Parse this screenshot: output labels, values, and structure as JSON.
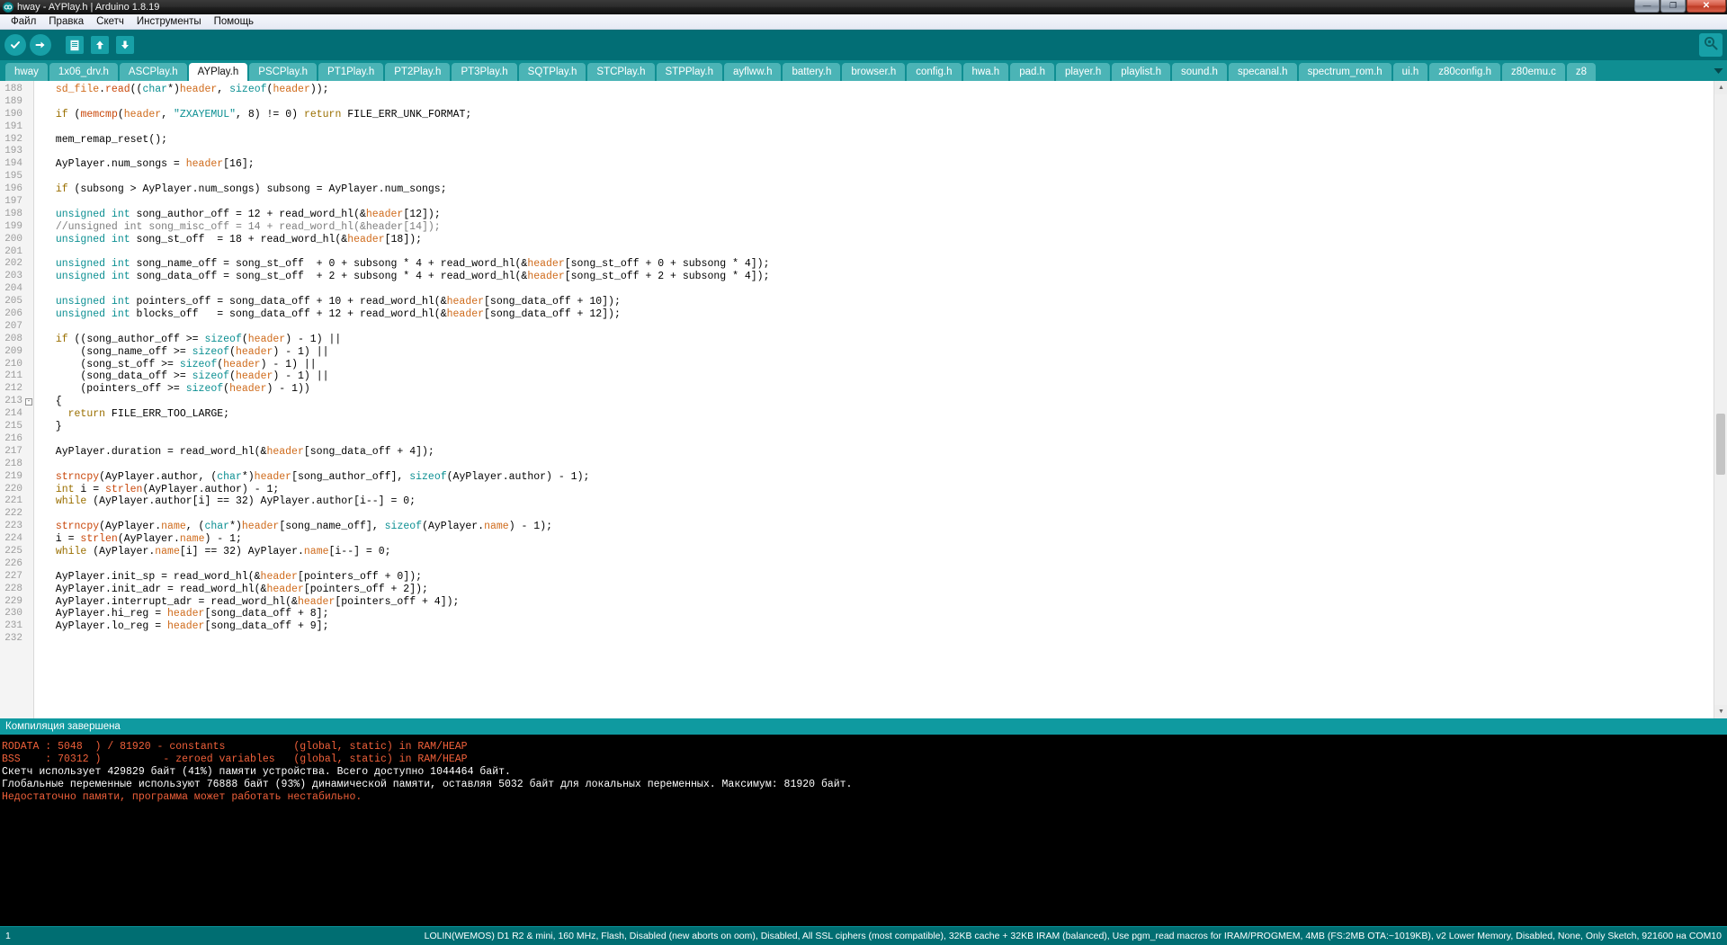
{
  "window": {
    "title": "hway - AYPlay.h | Arduino 1.8.19",
    "app_icon": "arduino-infinity-icon",
    "minimize_glyph": "—",
    "maximize_glyph": "❐",
    "close_glyph": "✕"
  },
  "menubar": {
    "items": [
      {
        "label": "Файл",
        "name": "menu-file"
      },
      {
        "label": "Правка",
        "name": "menu-edit"
      },
      {
        "label": "Скетч",
        "name": "menu-sketch"
      },
      {
        "label": "Инструменты",
        "name": "menu-tools"
      },
      {
        "label": "Помощь",
        "name": "menu-help"
      }
    ]
  },
  "toolbar": {
    "buttons": [
      {
        "name": "verify-button",
        "icon": "checkmark-icon",
        "glyph": "✔",
        "shape": "round"
      },
      {
        "name": "upload-button",
        "icon": "arrow-right-icon",
        "glyph": "➜",
        "shape": "round"
      },
      {
        "name": "new-button",
        "icon": "new-file-icon",
        "glyph": "▤",
        "shape": "square"
      },
      {
        "name": "open-button",
        "icon": "arrow-up-icon",
        "glyph": "▲",
        "shape": "square"
      },
      {
        "name": "save-button",
        "icon": "arrow-down-icon",
        "glyph": "▼",
        "shape": "square"
      }
    ],
    "serial_monitor": {
      "name": "serial-monitor-button",
      "icon": "magnifier-icon",
      "glyph": "🔍"
    }
  },
  "tabs": {
    "active": "AYPlay.h",
    "scroll_glyph": "▼",
    "items": [
      "hway",
      "1x06_drv.h",
      "ASCPlay.h",
      "AYPlay.h",
      "PSCPlay.h",
      "PT1Play.h",
      "PT2Play.h",
      "PT3Play.h",
      "SQTPlay.h",
      "STCPlay.h",
      "STPPlay.h",
      "ayflww.h",
      "battery.h",
      "browser.h",
      "config.h",
      "hwa.h",
      "pad.h",
      "player.h",
      "playlist.h",
      "sound.h",
      "specanal.h",
      "spectrum_rom.h",
      "ui.h",
      "z80config.h",
      "z80emu.c",
      "z8"
    ]
  },
  "editor": {
    "first_line": 188,
    "fold_line": 213,
    "fold_glyph": "⊟",
    "lines": [
      {
        "n": 188,
        "html": "  <span class=\"var\">sd_file</span>.<span class=\"fn\">read</span>((<span class=\"typ\">char</span>*)<span class=\"var\">header</span>, <span class=\"typ\">sizeof</span>(<span class=\"var\">header</span>));"
      },
      {
        "n": 189,
        "html": ""
      },
      {
        "n": 190,
        "html": "  <span class=\"kw\">if</span> (<span class=\"fn\">memcmp</span>(<span class=\"var\">header</span>, <span class=\"str\">\"ZXAYEMUL\"</span>, 8) != 0) <span class=\"kw\">return</span> FILE_ERR_UNK_FORMAT;"
      },
      {
        "n": 191,
        "html": ""
      },
      {
        "n": 192,
        "html": "  mem_remap_reset();"
      },
      {
        "n": 193,
        "html": ""
      },
      {
        "n": 194,
        "html": "  AyPlayer.num_songs = <span class=\"var\">header</span>[16];"
      },
      {
        "n": 195,
        "html": ""
      },
      {
        "n": 196,
        "html": "  <span class=\"kw\">if</span> (subsong &gt; AyPlayer.num_songs) subsong = AyPlayer.num_songs;"
      },
      {
        "n": 197,
        "html": ""
      },
      {
        "n": 198,
        "html": "  <span class=\"typ\">unsigned int</span> song_author_off = 12 + read_word_hl(&amp;<span class=\"var\">header</span>[12]);"
      },
      {
        "n": 199,
        "html": "  <span class=\"cmt\">//unsigned int song_misc_off = 14 + read_word_hl(&amp;header[14]);</span>"
      },
      {
        "n": 200,
        "html": "  <span class=\"typ\">unsigned int</span> song_st_off  = 18 + read_word_hl(&amp;<span class=\"var\">header</span>[18]);"
      },
      {
        "n": 201,
        "html": ""
      },
      {
        "n": 202,
        "html": "  <span class=\"typ\">unsigned int</span> song_name_off = song_st_off  + 0 + subsong * 4 + read_word_hl(&amp;<span class=\"var\">header</span>[song_st_off + 0 + subsong * 4]);"
      },
      {
        "n": 203,
        "html": "  <span class=\"typ\">unsigned int</span> song_data_off = song_st_off  + 2 + subsong * 4 + read_word_hl(&amp;<span class=\"var\">header</span>[song_st_off + 2 + subsong * 4]);"
      },
      {
        "n": 204,
        "html": ""
      },
      {
        "n": 205,
        "html": "  <span class=\"typ\">unsigned int</span> pointers_off = song_data_off + 10 + read_word_hl(&amp;<span class=\"var\">header</span>[song_data_off + 10]);"
      },
      {
        "n": 206,
        "html": "  <span class=\"typ\">unsigned int</span> blocks_off   = song_data_off + 12 + read_word_hl(&amp;<span class=\"var\">header</span>[song_data_off + 12]);"
      },
      {
        "n": 207,
        "html": ""
      },
      {
        "n": 208,
        "html": "  <span class=\"kw\">if</span> ((song_author_off &gt;= <span class=\"typ\">sizeof</span>(<span class=\"var\">header</span>) - 1) ||"
      },
      {
        "n": 209,
        "html": "      (song_name_off &gt;= <span class=\"typ\">sizeof</span>(<span class=\"var\">header</span>) - 1) ||"
      },
      {
        "n": 210,
        "html": "      (song_st_off &gt;= <span class=\"typ\">sizeof</span>(<span class=\"var\">header</span>) - 1) ||"
      },
      {
        "n": 211,
        "html": "      (song_data_off &gt;= <span class=\"typ\">sizeof</span>(<span class=\"var\">header</span>) - 1) ||"
      },
      {
        "n": 212,
        "html": "      (pointers_off &gt;= <span class=\"typ\">sizeof</span>(<span class=\"var\">header</span>) - 1))"
      },
      {
        "n": 213,
        "html": "  {"
      },
      {
        "n": 214,
        "html": "    <span class=\"kw\">return</span> FILE_ERR_TOO_LARGE;"
      },
      {
        "n": 215,
        "html": "  }"
      },
      {
        "n": 216,
        "html": ""
      },
      {
        "n": 217,
        "html": "  AyPlayer.duration = read_word_hl(&amp;<span class=\"var\">header</span>[song_data_off + 4]);"
      },
      {
        "n": 218,
        "html": ""
      },
      {
        "n": 219,
        "html": "  <span class=\"fn\">strncpy</span>(AyPlayer.author, (<span class=\"typ\">char</span>*)<span class=\"var\">header</span>[song_author_off], <span class=\"typ\">sizeof</span>(AyPlayer.author) - 1);"
      },
      {
        "n": 220,
        "html": "  <span class=\"kw\">int</span> i = <span class=\"fn\">strlen</span>(AyPlayer.author) - 1;"
      },
      {
        "n": 221,
        "html": "  <span class=\"kw\">while</span> (AyPlayer.author[i] == 32) AyPlayer.author[i--] = 0;"
      },
      {
        "n": 222,
        "html": ""
      },
      {
        "n": 223,
        "html": "  <span class=\"fn\">strncpy</span>(AyPlayer.<span class=\"var\">name</span>, (<span class=\"typ\">char</span>*)<span class=\"var\">header</span>[song_name_off], <span class=\"typ\">sizeof</span>(AyPlayer.<span class=\"var\">name</span>) - 1);"
      },
      {
        "n": 224,
        "html": "  i = <span class=\"fn\">strlen</span>(AyPlayer.<span class=\"var\">name</span>) - 1;"
      },
      {
        "n": 225,
        "html": "  <span class=\"kw\">while</span> (AyPlayer.<span class=\"var\">name</span>[i] == 32) AyPlayer.<span class=\"var\">name</span>[i--] = 0;"
      },
      {
        "n": 226,
        "html": ""
      },
      {
        "n": 227,
        "html": "  AyPlayer.init_sp = read_word_hl(&amp;<span class=\"var\">header</span>[pointers_off + 0]);"
      },
      {
        "n": 228,
        "html": "  AyPlayer.init_adr = read_word_hl(&amp;<span class=\"var\">header</span>[pointers_off + 2]);"
      },
      {
        "n": 229,
        "html": "  AyPlayer.interrupt_adr = read_word_hl(&amp;<span class=\"var\">header</span>[pointers_off + 4]);"
      },
      {
        "n": 230,
        "html": "  AyPlayer.hi_reg = <span class=\"var\">header</span>[song_data_off + 8];"
      },
      {
        "n": 231,
        "html": "  AyPlayer.lo_reg = <span class=\"var\">header</span>[song_data_off + 9];"
      },
      {
        "n": 232,
        "html": ""
      }
    ]
  },
  "console": {
    "status_label": "Компиляция завершена",
    "lines": [
      {
        "text": "RODATA : 5048  ) / 81920 - constants           (global, static) in RAM/HEAP",
        "color": "orange"
      },
      {
        "text": "BSS    : 70312 )          - zeroed variables   (global, static) in RAM/HEAP",
        "color": "orange"
      },
      {
        "text": "Скетч использует 429829 байт (41%) памяти устройства. Всего доступно 1044464 байт.",
        "color": "white"
      },
      {
        "text": "Глобальные переменные используют 76888 байт (93%) динамической памяти, оставляя 5032 байт для локальных переменных. Максимум: 81920 байт.",
        "color": "white"
      },
      {
        "text": "Недостаточно памяти, программа может работать нестабильно.",
        "color": "orange"
      }
    ]
  },
  "statusbar": {
    "line_number": "1",
    "board_info": "LOLIN(WEMOS) D1 R2 & mini, 160 MHz, Flash, Disabled (new aborts on oom), Disabled, All SSL ciphers (most compatible), 32KB cache + 32KB IRAM (balanced), Use pgm_read macros for IRAM/PROGMEM, 4MB (FS:2MB OTA:~1019KB), v2 Lower Memory, Disabled, None, Only Sketch, 921600 на COM10"
  }
}
